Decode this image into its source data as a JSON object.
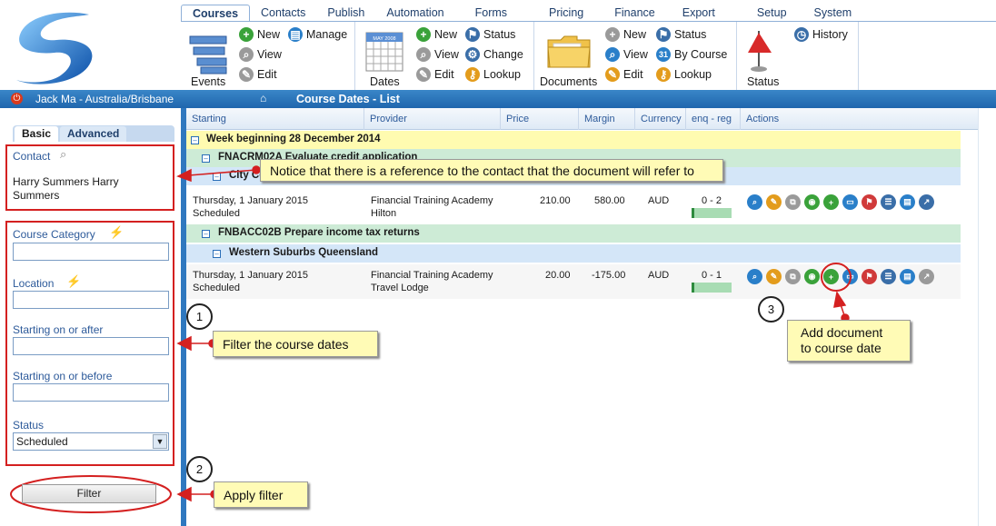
{
  "nav": {
    "tabs": [
      "Courses",
      "Contacts",
      "Publish",
      "Automation",
      "Forms",
      "Pricing",
      "Finance",
      "Export",
      "Setup",
      "System"
    ],
    "active_tab": "Courses"
  },
  "ribbon": {
    "events": {
      "big_label": "Events",
      "new": "New",
      "view": "View",
      "edit": "Edit",
      "manage": "Manage"
    },
    "dates": {
      "big_label": "Dates",
      "calendar_header": "MAY 2008",
      "new": "New",
      "view": "View",
      "edit": "Edit",
      "status": "Status",
      "change": "Change",
      "lookup": "Lookup"
    },
    "documents": {
      "big_label": "Documents",
      "new": "New",
      "view": "View",
      "edit": "Edit",
      "status": "Status",
      "by_course": "By Course",
      "lookup": "Lookup",
      "by_course_icon_num": "31"
    },
    "status": {
      "big_label": "Status",
      "history": "History"
    }
  },
  "userbar": {
    "user": "Jack Ma - Australia/Brisbane",
    "page_title": "Course Dates - List"
  },
  "sidebar": {
    "tabs": [
      "Basic",
      "Advanced"
    ],
    "contact_label": "Contact",
    "contact_value": "Harry Summers Harry Summers",
    "course_category_label": "Course Category",
    "location_label": "Location",
    "start_after_label": "Starting on or after",
    "start_before_label": "Starting on or before",
    "status_label": "Status",
    "status_value": "Scheduled",
    "filter_button": "Filter"
  },
  "grid": {
    "columns": [
      "Starting",
      "Provider",
      "Price",
      "Margin",
      "Currency",
      "enq - reg",
      "Actions"
    ],
    "week_group": "Week beginning 28 December 2014",
    "course1_group": "FNACRM02A Evaluate credit application",
    "course1_location": "City Centre",
    "row1": {
      "date": "Thursday, 1 January 2015",
      "status": "Scheduled",
      "provider": "Financial Training Academy",
      "venue": "Hilton",
      "price": "210.00",
      "margin": "580.00",
      "currency": "AUD",
      "enq": "0 - 2"
    },
    "course2_group": "FNBACC02B Prepare income tax returns",
    "course2_location": "Western Suburbs Queensland",
    "row2": {
      "date": "Thursday, 1 January 2015",
      "status": "Scheduled",
      "provider": "Financial Training Academy",
      "venue": "Travel Lodge",
      "price": "20.00",
      "margin": "-175.00",
      "currency": "AUD",
      "enq": "0 - 1"
    }
  },
  "callouts": {
    "contact_note": "Notice that there is a reference to the contact that the document will refer to",
    "filter_note": "Filter the course dates",
    "apply_note": "Apply filter",
    "add_doc_note_line1": "Add document",
    "add_doc_note_line2": "to course date",
    "step1": "1",
    "step2": "2",
    "step3": "3"
  },
  "colors": {
    "accent": "#2f78bf",
    "annotation_red": "#d42020",
    "callout_bg": "#fffbb6"
  }
}
